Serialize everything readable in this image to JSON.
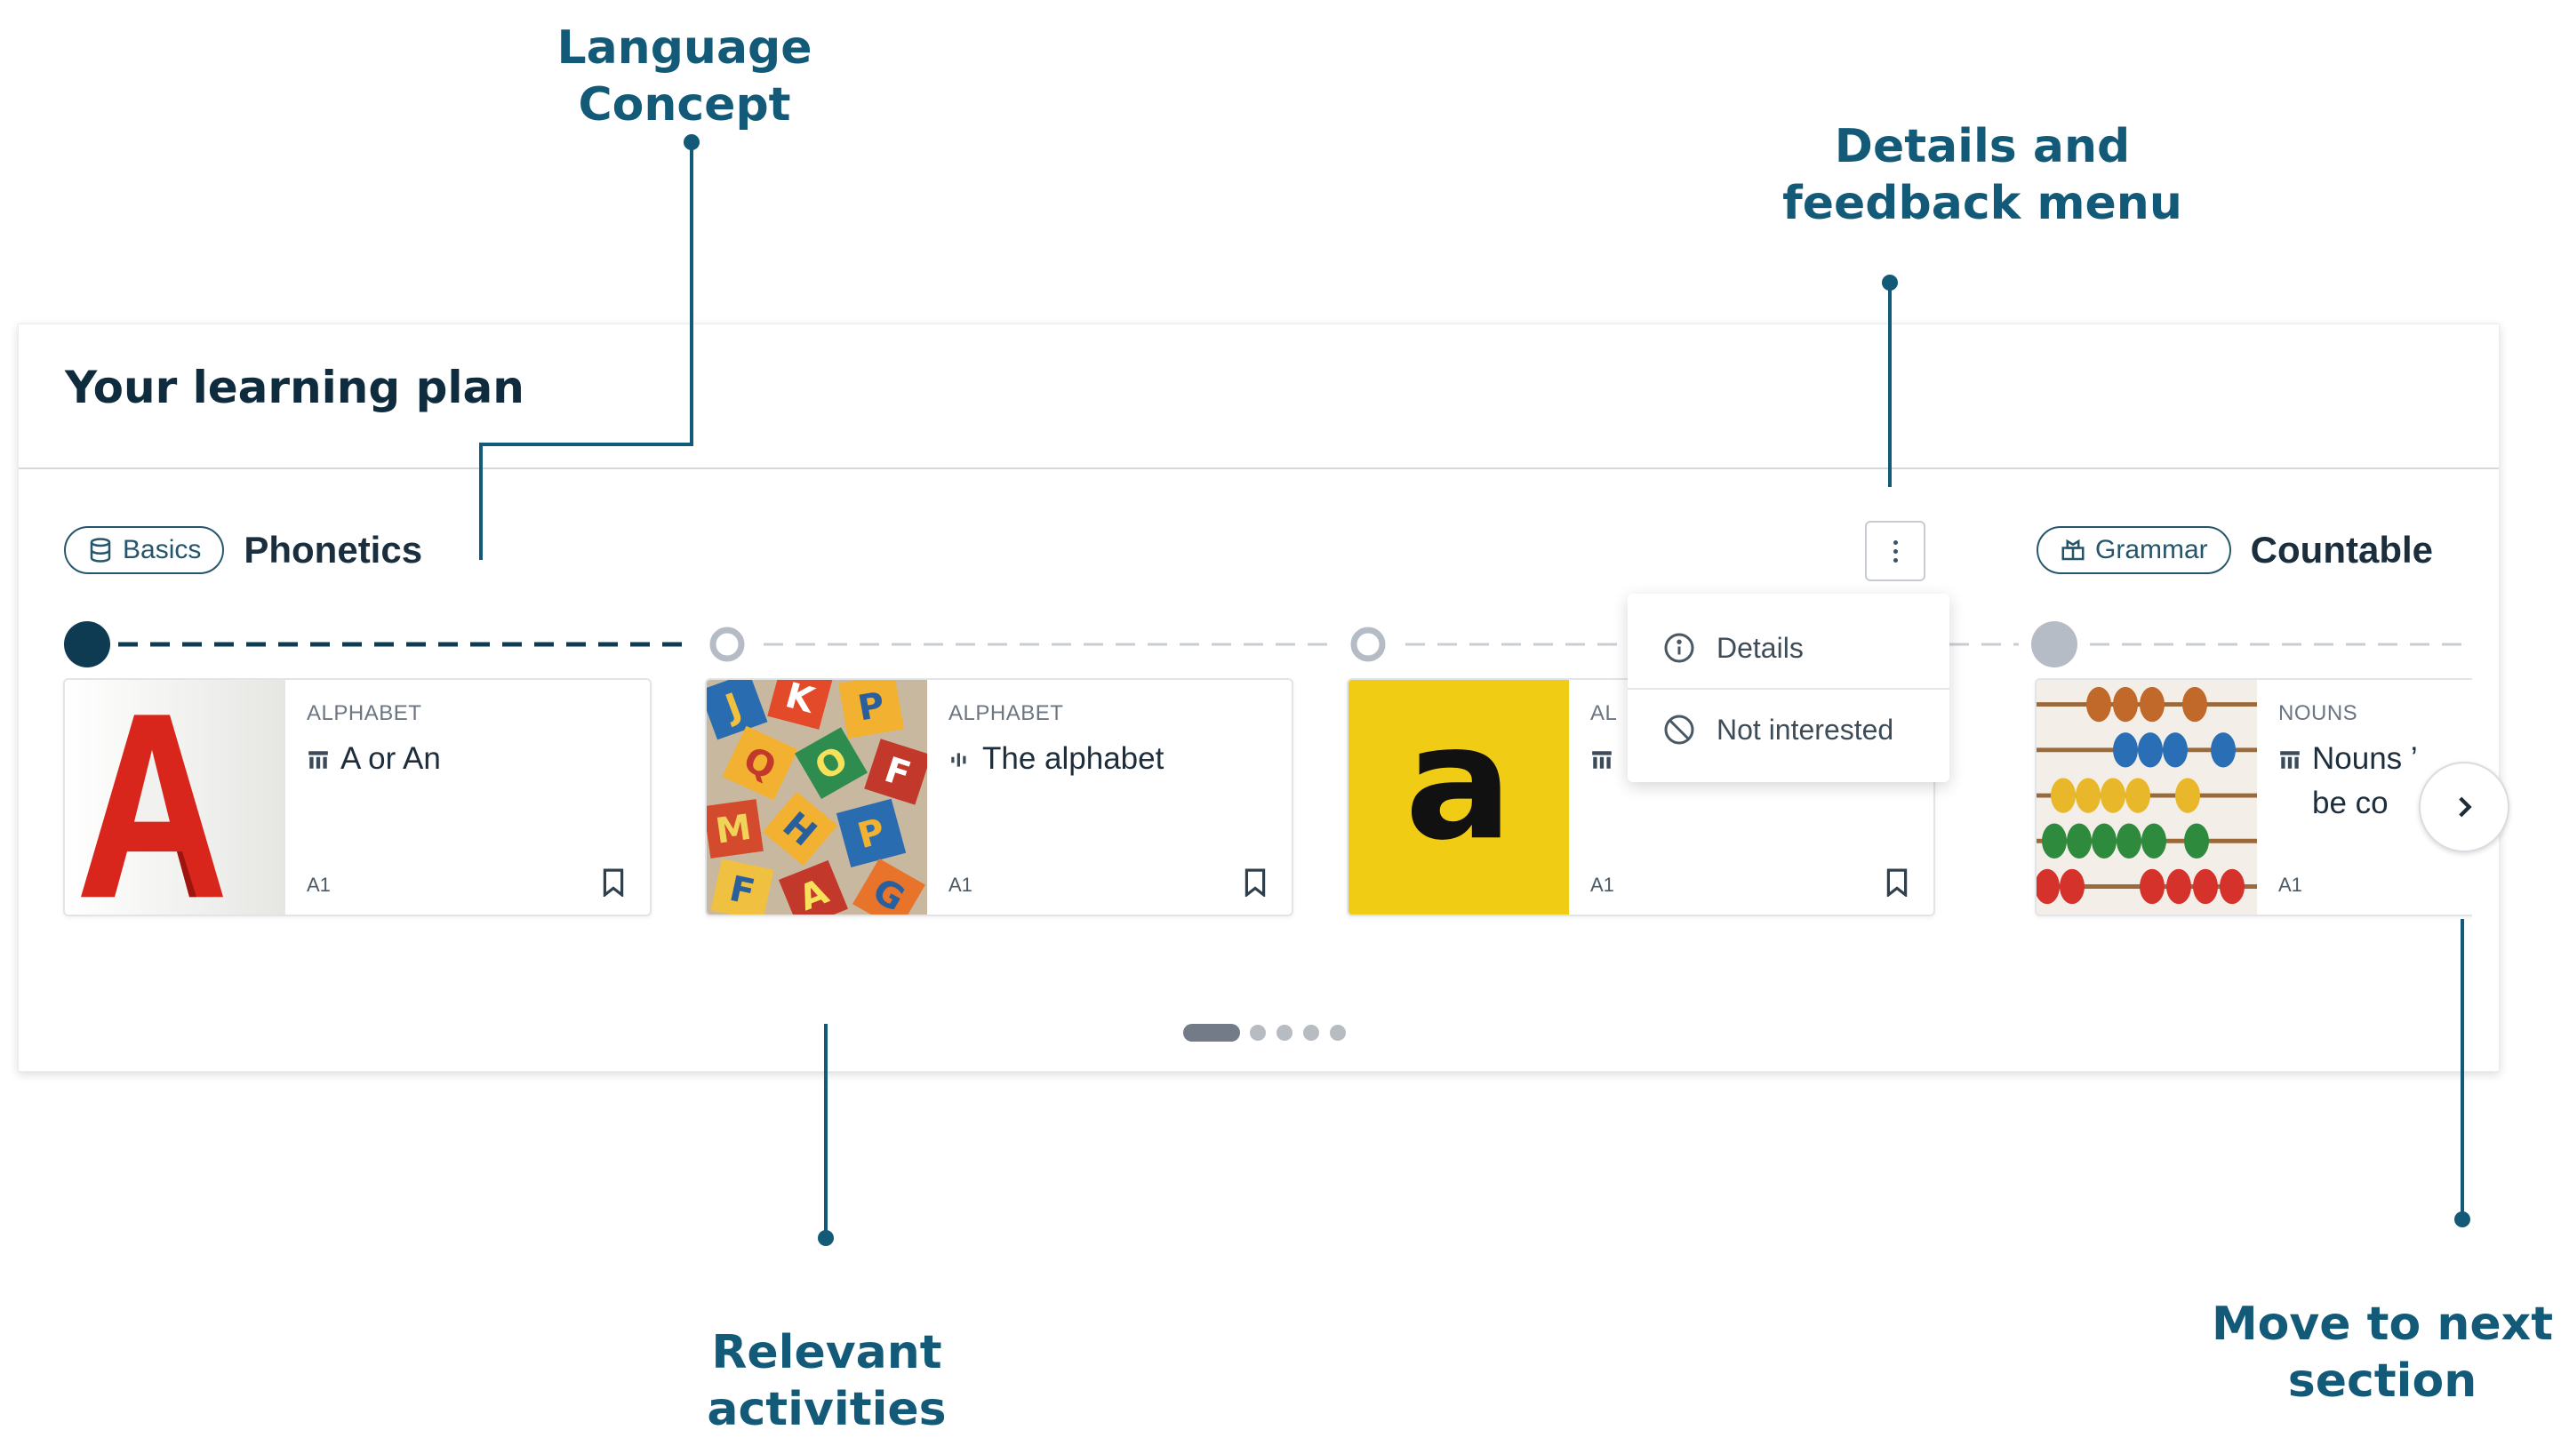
{
  "callouts": {
    "language_concept": [
      "Language",
      "Concept"
    ],
    "details_menu": [
      "Details and",
      "feedback menu"
    ],
    "relevant_activities": [
      "Relevant",
      "activities"
    ],
    "next_section": [
      "Move to next",
      "section"
    ]
  },
  "panel": {
    "title": "Your learning plan"
  },
  "concepts": [
    {
      "badge": "Basics",
      "badge_icon": "database-icon",
      "name": "Phonetics"
    },
    {
      "badge": "Grammar",
      "badge_icon": "grammar-book-icon",
      "name": "Countable"
    }
  ],
  "cards": [
    {
      "category": "ALPHABET",
      "title": "A or An",
      "title_icon": "list-icon",
      "level": "A1",
      "image": "red-letter-a"
    },
    {
      "category": "ALPHABET",
      "title": "The alphabet",
      "title_icon": "audio-icon",
      "level": "A1",
      "image": "letter-tiles"
    },
    {
      "category": "AL",
      "title": "",
      "title_icon": "list-icon",
      "level": "A1",
      "image": "yellow-letter-a"
    },
    {
      "category": "NOUNS",
      "title": "Nouns ’ be co",
      "title_line1": "Nouns ’",
      "title_line2": "be co",
      "title_icon": "list-icon",
      "level": "A1",
      "image": "abacus"
    }
  ],
  "menu": {
    "items": [
      {
        "label": "Details",
        "icon": "info-icon"
      },
      {
        "label": "Not interested",
        "icon": "block-icon"
      }
    ]
  },
  "pagination": {
    "pages": 5,
    "current": 1
  },
  "colors": {
    "accent": "#125a77",
    "dark": "#0f3b52",
    "node_future": "#b5bcc5",
    "pill": "#25556b"
  }
}
